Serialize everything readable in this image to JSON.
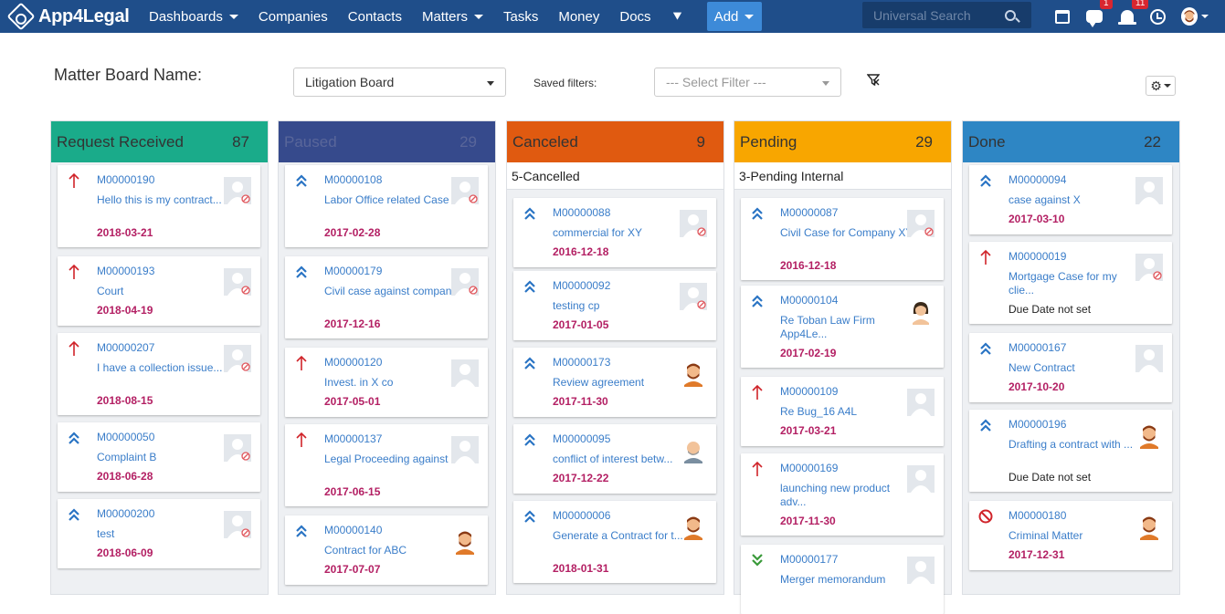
{
  "nav": {
    "brand": "App4Legal",
    "items": [
      {
        "label": "Dashboards",
        "caret": true
      },
      {
        "label": "Companies",
        "caret": false
      },
      {
        "label": "Contacts",
        "caret": false
      },
      {
        "label": "Matters",
        "caret": true
      },
      {
        "label": "Tasks",
        "caret": false
      },
      {
        "label": "Money",
        "caret": false
      },
      {
        "label": "Docs",
        "caret": false
      }
    ],
    "more_icon": "double-chevron-down-icon",
    "add_label": "Add",
    "search_placeholder": "Universal Search",
    "chat_badge": "1",
    "notif_badge": "11"
  },
  "filters": {
    "board_label": "Matter Board Name:",
    "board_value": "Litigation Board",
    "saved_label": "Saved filters:",
    "saved_placeholder": "--- Select Filter ---"
  },
  "columns": [
    {
      "name": "Request Received",
      "count": "87",
      "color": "#1aab8a",
      "text_color": "#333",
      "sub": "",
      "cards": [
        {
          "id": "M00000190",
          "title": "Hello this is my contract...",
          "date": "2018-03-21",
          "priority": "high",
          "avatar": "none"
        },
        {
          "id": "M00000193",
          "title": "Court",
          "date": "2018-04-19",
          "priority": "high",
          "avatar": "none"
        },
        {
          "id": "M00000207",
          "title": "I have a collection issue...",
          "date": "2018-08-15",
          "priority": "high",
          "avatar": "none"
        },
        {
          "id": "M00000050",
          "title": "Complaint B",
          "date": "2018-06-28",
          "priority": "medium",
          "avatar": "none"
        },
        {
          "id": "M00000200",
          "title": "test",
          "date": "2018-06-09",
          "priority": "medium",
          "avatar": "none"
        }
      ]
    },
    {
      "name": "Paused",
      "count": "29",
      "color": "#364a8c",
      "text_color": "#59669a",
      "sub": "",
      "cards": [
        {
          "id": "M00000108",
          "title": "Labor Office related Case",
          "date": "2017-02-28",
          "priority": "medium",
          "avatar": "none"
        },
        {
          "id": "M00000179",
          "title": "Civil case against compan...",
          "date": "2017-12-16",
          "priority": "medium",
          "avatar": "none"
        },
        {
          "id": "M00000120",
          "title": "Invest. in X co",
          "date": "2017-05-01",
          "priority": "high",
          "avatar": "blank"
        },
        {
          "id": "M00000137",
          "title": "Legal Proceeding against ...",
          "date": "2017-06-15",
          "priority": "high",
          "avatar": "blank"
        },
        {
          "id": "M00000140",
          "title": "Contract for ABC",
          "date": "2017-07-07",
          "priority": "medium",
          "avatar": "man"
        }
      ]
    },
    {
      "name": "Canceled",
      "count": "9",
      "color": "#e05a10",
      "text_color": "#333",
      "sub": "5-Cancelled",
      "cards": [
        {
          "id": "M00000088",
          "title": "commercial for XY",
          "date": "2016-12-18",
          "priority": "medium",
          "avatar": "none"
        },
        {
          "id": "M00000092",
          "title": "testing cp",
          "date": "2017-01-05",
          "priority": "medium",
          "avatar": "none"
        },
        {
          "id": "M00000173",
          "title": "Review agreement",
          "date": "2017-11-30",
          "priority": "medium",
          "avatar": "man"
        },
        {
          "id": "M00000095",
          "title": "conflict of interest betw...",
          "date": "2017-12-22",
          "priority": "medium",
          "avatar": "bald"
        },
        {
          "id": "M00000006",
          "title": "Generate a Contract for t...",
          "date": "2018-01-31",
          "priority": "medium",
          "avatar": "man"
        }
      ]
    },
    {
      "name": "Pending",
      "count": "29",
      "color": "#f8a600",
      "text_color": "#333",
      "sub": "3-Pending Internal",
      "cards": [
        {
          "id": "M00000087",
          "title": "Civil Case for Company XY",
          "date": "2016-12-18",
          "priority": "medium",
          "avatar": "none"
        },
        {
          "id": "M00000104",
          "title": "Re Toban Law Firm App4Le...",
          "date": "2017-02-19",
          "priority": "medium",
          "avatar": "woman"
        },
        {
          "id": "M00000109",
          "title": "Re Bug_16 A4L",
          "date": "2017-03-21",
          "priority": "high",
          "avatar": "blank"
        },
        {
          "id": "M00000169",
          "title": "launching new product adv...",
          "date": "2017-11-30",
          "priority": "high",
          "avatar": "blank"
        },
        {
          "id": "M00000177",
          "title": "Merger memorandum",
          "date": "",
          "priority": "low",
          "avatar": "blank"
        }
      ]
    },
    {
      "name": "Done",
      "count": "22",
      "color": "#2e86c4",
      "text_color": "#333",
      "sub": "",
      "cards": [
        {
          "id": "M00000094",
          "title": "case against X",
          "date": "2017-03-10",
          "priority": "medium",
          "avatar": "blank"
        },
        {
          "id": "M00000019",
          "title": "Mortgage Case for my clie...",
          "date": "Due Date not set",
          "priority": "high",
          "avatar": "none"
        },
        {
          "id": "M00000167",
          "title": "New Contract",
          "date": "2017-10-20",
          "priority": "medium",
          "avatar": "blank"
        },
        {
          "id": "M00000196",
          "title": "Drafting a contract with ...",
          "date": "Due Date not set",
          "priority": "medium",
          "avatar": "man"
        },
        {
          "id": "M00000180",
          "title": "Criminal Matter",
          "date": "2017-12-31",
          "priority": "blocked",
          "avatar": "man"
        }
      ]
    }
  ]
}
